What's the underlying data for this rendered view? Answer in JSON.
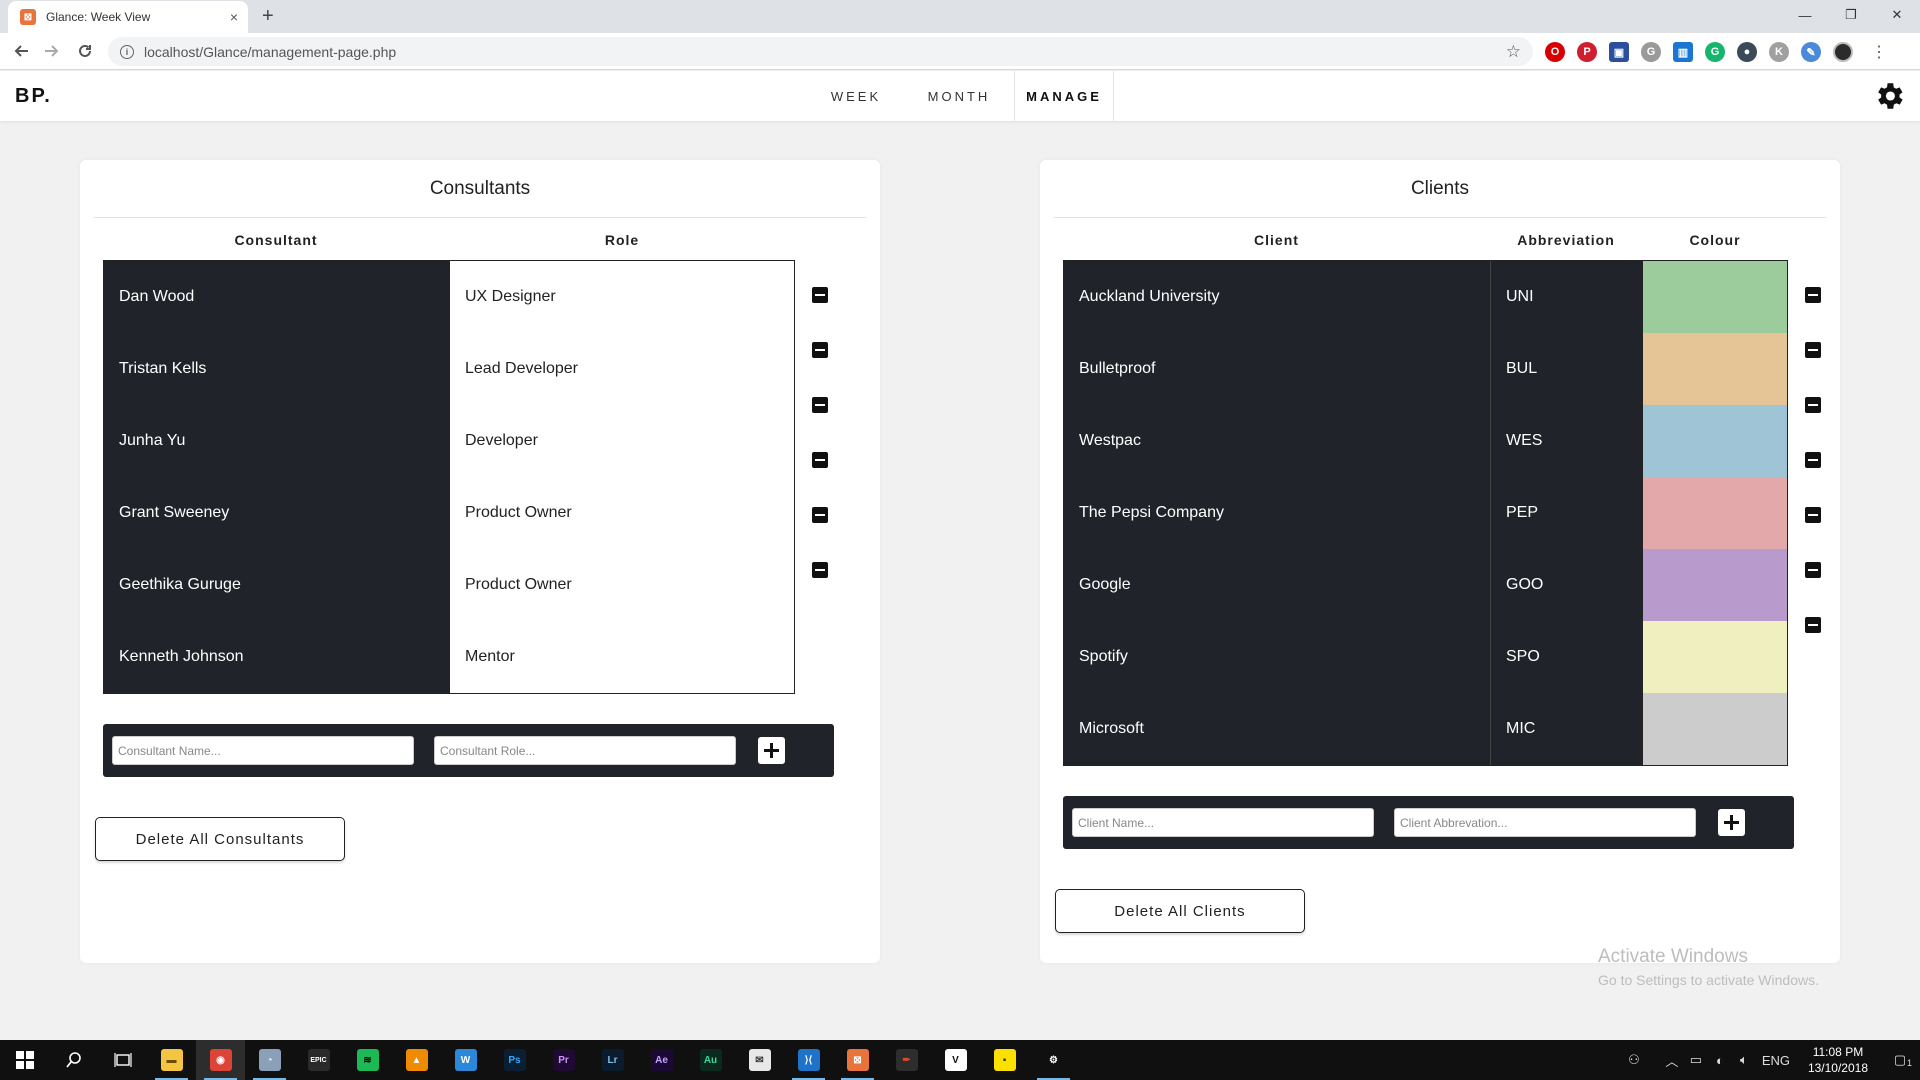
{
  "browser": {
    "tab_title": "Glance: Week View",
    "tab_close": "×",
    "new_tab": "+",
    "url": "localhost/Glance/management-page.php",
    "window": {
      "minimize": "—",
      "restore": "❐",
      "close": "✕"
    },
    "extensions": [
      {
        "name": "opera-icon",
        "color": "#d80000",
        "glyph": "O"
      },
      {
        "name": "pinterest-icon",
        "color": "#cf1f2e",
        "glyph": "P"
      },
      {
        "name": "reader-icon",
        "color": "#2b4f9e",
        "glyph": "▣"
      },
      {
        "name": "grammarly-g-icon",
        "color": "#9a9a9a",
        "glyph": "G"
      },
      {
        "name": "trello-icon",
        "color": "#1976d2",
        "glyph": "▥"
      },
      {
        "name": "grammarly-icon",
        "color": "#15b56d",
        "glyph": "G"
      },
      {
        "name": "extension-dark-icon",
        "color": "#3b4a5a",
        "glyph": "●"
      },
      {
        "name": "extension-gray-icon",
        "color": "#a0a0a0",
        "glyph": "K"
      },
      {
        "name": "eyedropper-icon",
        "color": "#4a8ad8",
        "glyph": "✎"
      }
    ]
  },
  "app": {
    "logo": "BP.",
    "nav": [
      {
        "label": "WEEK"
      },
      {
        "label": "MONTH"
      },
      {
        "label": "MANAGE",
        "active": true
      }
    ]
  },
  "consultants": {
    "title": "Consultants",
    "headers": [
      "Consultant",
      "Role"
    ],
    "rows": [
      {
        "name": "Dan Wood",
        "role": "UX Designer"
      },
      {
        "name": "Tristan Kells",
        "role": "Lead Developer"
      },
      {
        "name": "Junha Yu",
        "role": "Developer"
      },
      {
        "name": "Grant Sweeney",
        "role": "Product Owner"
      },
      {
        "name": "Geethika Guruge",
        "role": "Product Owner"
      },
      {
        "name": "Kenneth Johnson",
        "role": "Mentor"
      }
    ],
    "name_placeholder": "Consultant Name...",
    "role_placeholder": "Consultant Role...",
    "delete_all": "Delete All Consultants"
  },
  "clients": {
    "title": "Clients",
    "headers": [
      "Client",
      "Abbreviation",
      "Colour"
    ],
    "rows": [
      {
        "name": "Auckland University",
        "abbr": "UNI",
        "colour": "#9ccc9c"
      },
      {
        "name": "Bulletproof",
        "abbr": "BUL",
        "colour": "#e5c595"
      },
      {
        "name": "Westpac",
        "abbr": "WES",
        "colour": "#9fc4d6"
      },
      {
        "name": "The Pepsi Company",
        "abbr": "PEP",
        "colour": "#e3a9aa"
      },
      {
        "name": "Google",
        "abbr": "GOO",
        "colour": "#b99acc"
      },
      {
        "name": "Spotify",
        "abbr": "SPO",
        "colour": "#f0efbf"
      },
      {
        "name": "Microsoft",
        "abbr": "MIC",
        "colour": "#cccccc"
      }
    ],
    "name_placeholder": "Client Name...",
    "abbr_placeholder": "Client Abbrevation...",
    "delete_all": "Delete All Clients"
  },
  "watermark": {
    "line1": "Activate Windows",
    "line2": "Go to Settings to activate Windows."
  },
  "taskbar": {
    "apps": [
      {
        "name": "file-explorer-icon",
        "bg": "#f4c542",
        "fg": "#6b4c00",
        "glyph": "▬",
        "running": true
      },
      {
        "name": "chrome-icon",
        "bg": "#db4437",
        "fg": "#ffffff",
        "glyph": "◉",
        "running": true,
        "active": true
      },
      {
        "name": "fiddler-icon",
        "bg": "#8aa0b8",
        "fg": "#ffffff",
        "glyph": "◔",
        "running": true
      },
      {
        "name": "epic-games-icon",
        "bg": "#2a2a2a",
        "fg": "#ffffff",
        "glyph": "EPIC",
        "running": false
      },
      {
        "name": "spotify-icon",
        "bg": "#1db954",
        "fg": "#000000",
        "glyph": "≋",
        "running": false
      },
      {
        "name": "vlc-icon",
        "bg": "#f08a00",
        "fg": "#ffffff",
        "glyph": "▲",
        "running": false
      },
      {
        "name": "wunderlist-icon",
        "bg": "#2b88d9",
        "fg": "#ffffff",
        "glyph": "W",
        "running": false
      },
      {
        "name": "photoshop-icon",
        "bg": "#0a1f33",
        "fg": "#31a8ff",
        "glyph": "Ps",
        "running": false
      },
      {
        "name": "premiere-icon",
        "bg": "#1f0a33",
        "fg": "#d291ff",
        "glyph": "Pr",
        "running": false
      },
      {
        "name": "lightroom-icon",
        "bg": "#0a1c2e",
        "fg": "#7fbfe6",
        "glyph": "Lr",
        "running": false
      },
      {
        "name": "after-effects-icon",
        "bg": "#1a0a33",
        "fg": "#c6a2ff",
        "glyph": "Ae",
        "running": false
      },
      {
        "name": "audition-icon",
        "bg": "#0b2a1e",
        "fg": "#35d6a0",
        "glyph": "Au",
        "running": false
      },
      {
        "name": "mail-icon",
        "bg": "#e8e8e8",
        "fg": "#333333",
        "glyph": "✉",
        "running": false
      },
      {
        "name": "vscode-icon",
        "bg": "#1e73c8",
        "fg": "#ffffff",
        "glyph": "⟩⟨",
        "running": true
      },
      {
        "name": "xampp-icon",
        "bg": "#e8743b",
        "fg": "#ffffff",
        "glyph": "⊠",
        "running": true
      },
      {
        "name": "sketch-pen-icon",
        "bg": "#2d2d2d",
        "fg": "#e24a2a",
        "glyph": "✒",
        "running": false
      },
      {
        "name": "vectr-icon",
        "bg": "#ffffff",
        "fg": "#111111",
        "glyph": "V",
        "running": false
      },
      {
        "name": "sticky-notes-icon",
        "bg": "#fce100",
        "fg": "#333333",
        "glyph": "▪",
        "running": false
      },
      {
        "name": "settings-icon",
        "bg": "#101010",
        "fg": "#ffffff",
        "glyph": "⚙",
        "running": true
      }
    ],
    "tray": {
      "lang": "ENG",
      "time": "11:08 PM",
      "date": "13/10/2018",
      "notifications": "1"
    }
  }
}
